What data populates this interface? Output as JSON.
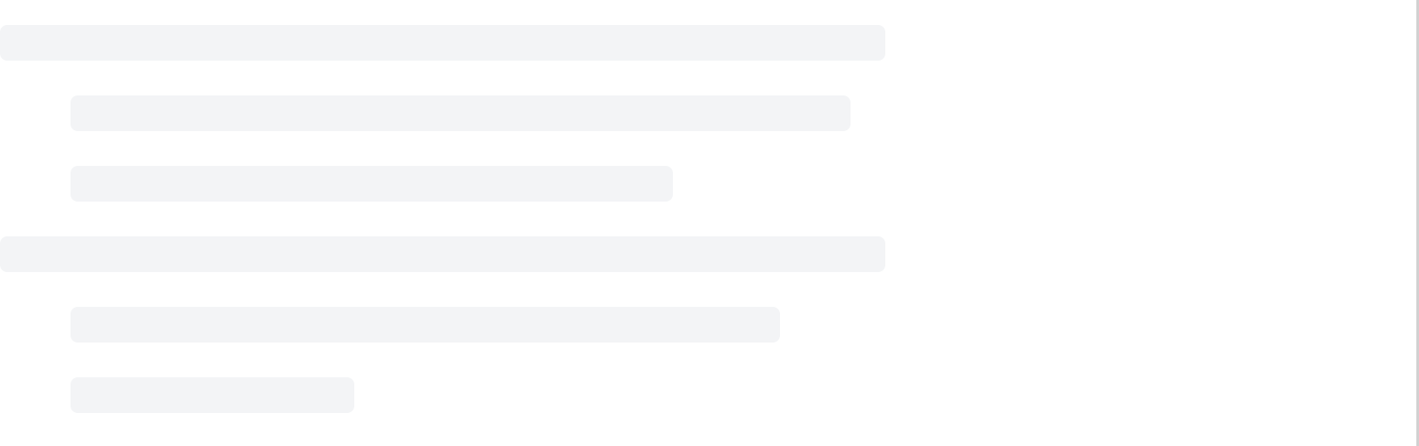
{
  "skeleton": {
    "state": "loading",
    "placeholder_count": 6,
    "color": "#f3f4f6",
    "groups": [
      {
        "level": 0,
        "children": [
          {
            "level": 1
          },
          {
            "level": 1
          }
        ]
      },
      {
        "level": 0,
        "children": [
          {
            "level": 1
          },
          {
            "level": 1
          }
        ]
      }
    ]
  },
  "colors": {
    "background": "#ffffff",
    "placeholder": "#f3f4f6",
    "edge": "#d1d1d1"
  }
}
